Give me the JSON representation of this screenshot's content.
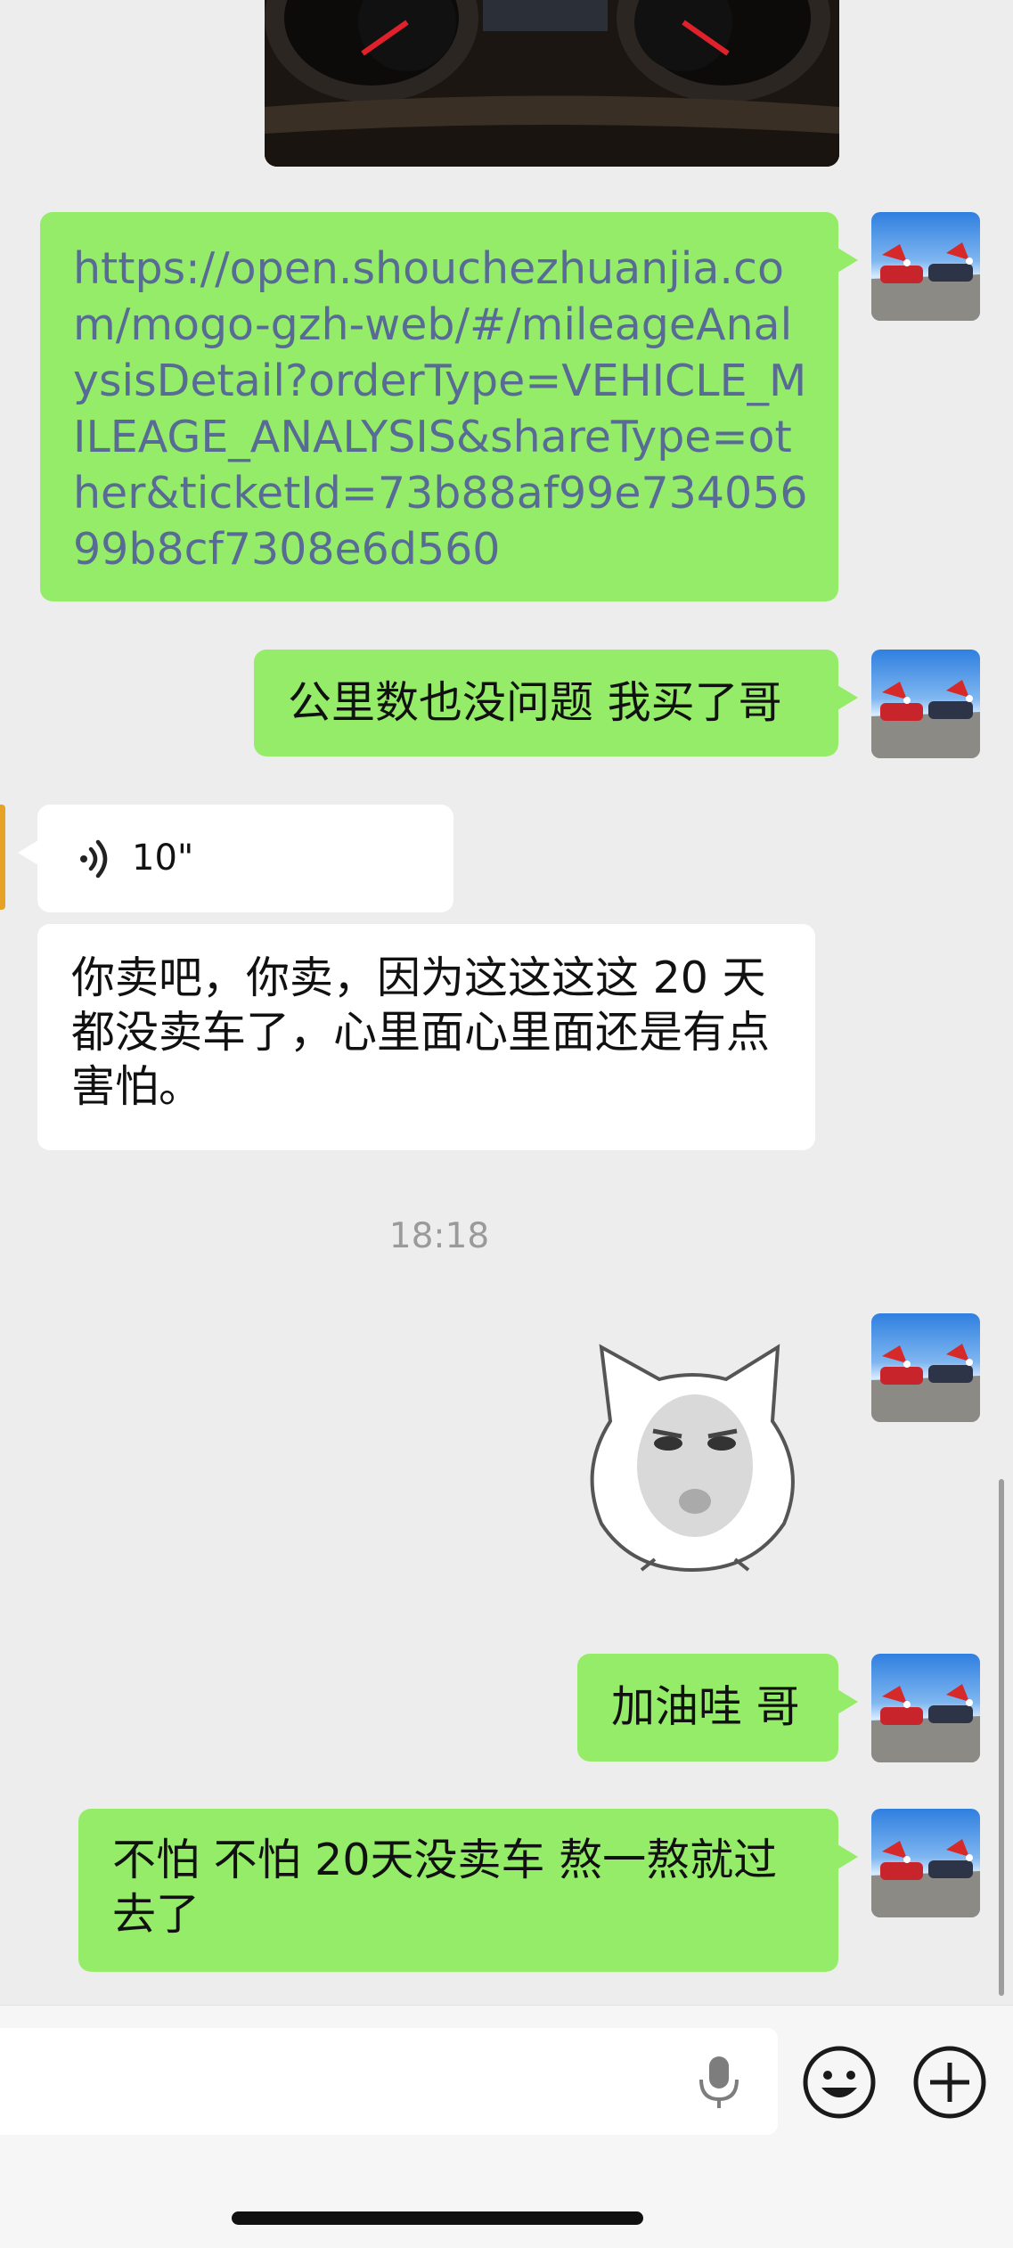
{
  "messages": {
    "link": {
      "text": "https://open.shouchezhuanjia.com/mogo-gzh-web/#/mileageAnalysisDetail?orderType=VEHICLE_MILEAGE_ANALYSIS&shareType=other&ticketId=73b88af99e73405699b8cf7308e6d560"
    },
    "mileage_ok": {
      "text": "公里数也没问题 我买了哥"
    },
    "voice": {
      "duration": "10\""
    },
    "reply_sell": {
      "text": "你卖吧，你卖，因为这这这这 20 天都没卖车了，心里面心里面还是有点害怕。"
    },
    "timestamp": "18:18",
    "cheer": {
      "text": "加油哇 哥"
    },
    "encourage": {
      "text": "不怕 不怕 20天没卖车 熬一熬就过去了"
    }
  },
  "colors": {
    "background": "#ededed",
    "sent_bubble": "#95ec69",
    "received_bubble": "#ffffff",
    "link_text": "#576b95",
    "timestamp": "#9a9a9a"
  },
  "icons": {
    "voice": "voice-wave-icon",
    "mic": "microphone-icon",
    "emoji": "emoji-icon",
    "plus": "plus-icon"
  }
}
